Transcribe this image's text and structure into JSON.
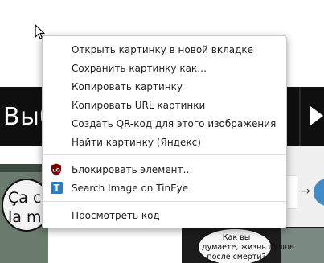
{
  "background": {
    "banner_text": "Выб",
    "left_bubble_text": "Ça c\nla m",
    "right_bubble_text": "Как вы\nдумаете, жизнь лучше\nпосле смерти?",
    "right_arrow": "→"
  },
  "context_menu": {
    "items": [
      {
        "label": "Открыть картинку в новой вкладке"
      },
      {
        "label": "Сохранить картинку как…"
      },
      {
        "label": "Копировать картинку"
      },
      {
        "label": "Копировать URL картинки"
      },
      {
        "label": "Создать QR-код для этого изображения"
      },
      {
        "label": "Найти картинку (Яндекс)"
      }
    ],
    "extensions": [
      {
        "label": "Блокировать элемент…",
        "icon": "ublock-origin-icon"
      },
      {
        "label": "Search Image on TinEye",
        "icon": "tineye-icon",
        "icon_glyph": "T"
      }
    ],
    "inspect": {
      "label": "Просмотреть код"
    }
  },
  "colors": {
    "ublock_red": "#800000",
    "tineye_blue": "#2f7bbf"
  }
}
